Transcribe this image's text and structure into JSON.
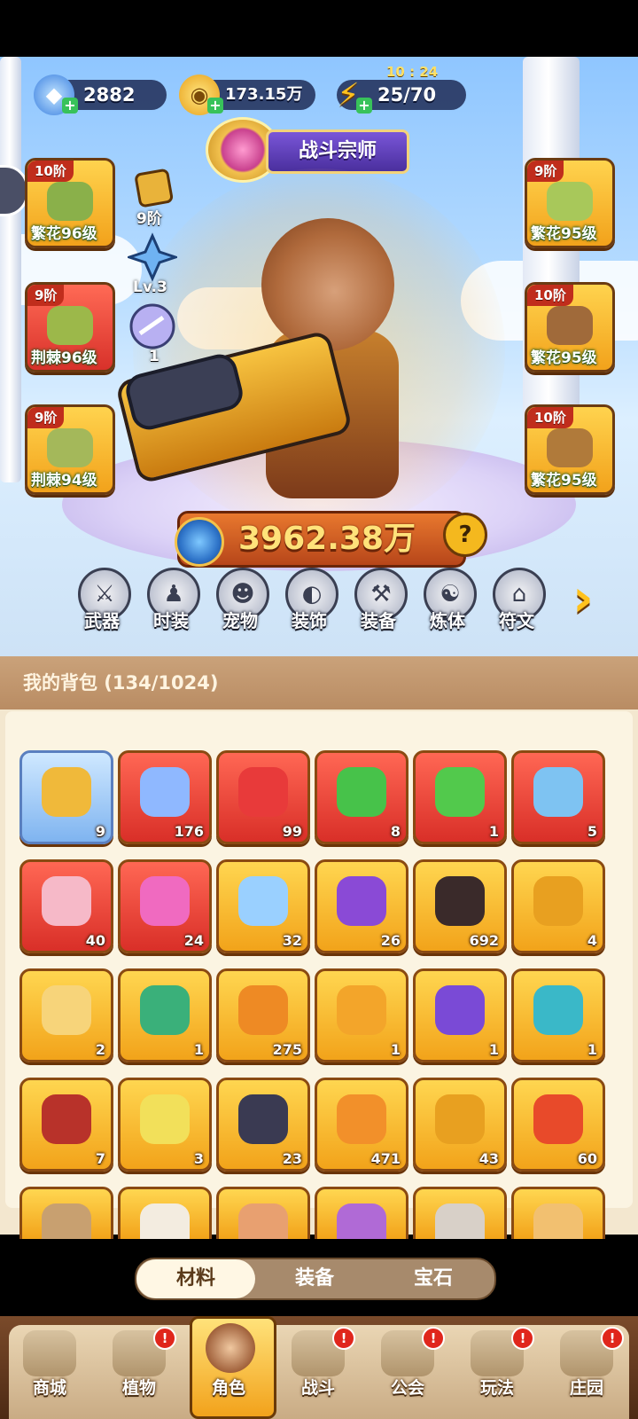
{
  "resources": {
    "gems": "2882",
    "gold": "173.15万",
    "energy": "25/70",
    "energy_timer": "10 : 24"
  },
  "title_badge": "战斗宗师",
  "left_slots": [
    {
      "tier": "10阶",
      "level": "繁花96级",
      "color": "gold"
    },
    {
      "tier": "9阶",
      "level": "荆棘96级",
      "color": "red"
    },
    {
      "tier": "9阶",
      "level": "荆棘94级",
      "color": "gold"
    }
  ],
  "right_slots": [
    {
      "tier": "9阶",
      "level": "繁花95级",
      "color": "gold"
    },
    {
      "tier": "10阶",
      "level": "繁花95级",
      "color": "gold"
    },
    {
      "tier": "10阶",
      "level": "繁花95级",
      "color": "gold"
    }
  ],
  "mini_stats": {
    "tier": "9阶",
    "level": "Lv.3",
    "count": "1"
  },
  "power": "3962.38万",
  "features": [
    "武器",
    "时装",
    "宠物",
    "装饰",
    "装备",
    "炼体",
    "符文"
  ],
  "bag": {
    "title": "我的背包 (134/1024)",
    "items": [
      {
        "icon": "star-gem-icon",
        "count": "9",
        "bg": "blue",
        "color": "#f0b93a"
      },
      {
        "icon": "crystal-star-icon",
        "count": "176",
        "bg": "red",
        "color": "#8fb8ff"
      },
      {
        "icon": "apple-potion-icon",
        "count": "99",
        "bg": "red",
        "color": "#e83a3a"
      },
      {
        "icon": "green-tube-icon",
        "count": "8",
        "bg": "red",
        "color": "#47c24a"
      },
      {
        "icon": "green-capsule-icon",
        "count": "1",
        "bg": "red",
        "color": "#52c94c"
      },
      {
        "icon": "blue-hexagram-icon",
        "count": "5",
        "bg": "red",
        "color": "#7ec3f2"
      },
      {
        "icon": "pink-knot-icon",
        "count": "40",
        "bg": "red",
        "color": "#f6b9c8"
      },
      {
        "icon": "lotus-pets-icon",
        "count": "24",
        "bg": "red",
        "color": "#f06ac0"
      },
      {
        "icon": "water-drop-icon",
        "count": "32",
        "bg": "gold",
        "color": "#9ad0ff"
      },
      {
        "icon": "skull-scroll-icon",
        "count": "26",
        "bg": "gold",
        "color": "#8a4ad6"
      },
      {
        "icon": "magic-hat-icon",
        "count": "692",
        "bg": "gold",
        "color": "#3a2a2a"
      },
      {
        "icon": "ruby-key-icon",
        "count": "4",
        "bg": "gold",
        "color": "#e8a020"
      },
      {
        "icon": "gold-key-icon",
        "count": "2",
        "bg": "gold",
        "color": "#f7d47a"
      },
      {
        "icon": "emerald-key-icon",
        "count": "1",
        "bg": "gold",
        "color": "#3ab07a"
      },
      {
        "icon": "amber-prism-icon",
        "count": "275",
        "bg": "gold",
        "color": "#ee8a24"
      },
      {
        "icon": "amber-cube-icon",
        "count": "1",
        "bg": "gold",
        "color": "#f3a52a"
      },
      {
        "icon": "purple-orb-icon",
        "count": "1",
        "bg": "gold",
        "color": "#7a4ad6"
      },
      {
        "icon": "cyan-mushroom-icon",
        "count": "1",
        "bg": "gold",
        "color": "#3ab8c8"
      },
      {
        "icon": "red-book-icon",
        "count": "7",
        "bg": "gold",
        "color": "#b8322a"
      },
      {
        "icon": "lemon-leaf-icon",
        "count": "3",
        "bg": "gold",
        "color": "#f2e05a"
      },
      {
        "icon": "dark-rune-icon",
        "count": "23",
        "bg": "gold",
        "color": "#3a3a52"
      },
      {
        "icon": "orange-potion-icon",
        "count": "471",
        "bg": "gold",
        "color": "#f2902a"
      },
      {
        "icon": "gold-nugget-icon",
        "count": "43",
        "bg": "gold",
        "color": "#e8a020"
      },
      {
        "icon": "red-flower-icon",
        "count": "60",
        "bg": "gold",
        "color": "#e84a2a"
      },
      {
        "icon": "mortar-icon",
        "count": "",
        "bg": "gold",
        "color": "#c8a070"
      },
      {
        "icon": "bone-icon",
        "count": "",
        "bg": "gold",
        "color": "#f3ece0"
      },
      {
        "icon": "pot-icon",
        "count": "",
        "bg": "gold",
        "color": "#e8a070"
      },
      {
        "icon": "purple-tome-icon",
        "count": "",
        "bg": "gold",
        "color": "#b06ad6"
      },
      {
        "icon": "silver-bowl-icon",
        "count": "",
        "bg": "gold",
        "color": "#d8d0c8"
      },
      {
        "icon": "cookie-icon",
        "count": "",
        "bg": "gold",
        "color": "#f2c070"
      }
    ]
  },
  "segment_tabs": [
    "材料",
    "装备",
    "宝石"
  ],
  "nav": [
    {
      "label": "商城",
      "badge": false
    },
    {
      "label": "植物",
      "badge": true
    },
    {
      "label": "角色",
      "badge": false,
      "active": true
    },
    {
      "label": "战斗",
      "badge": true
    },
    {
      "label": "公会",
      "badge": true
    },
    {
      "label": "玩法",
      "badge": true
    },
    {
      "label": "庄园",
      "badge": true
    }
  ],
  "badge_symbol": "!"
}
